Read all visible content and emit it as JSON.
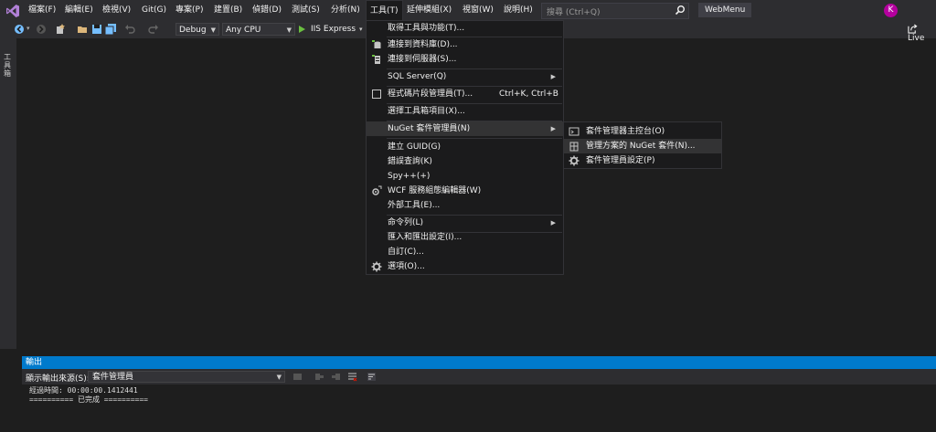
{
  "menubar": {
    "items": [
      "檔案(F)",
      "編輯(E)",
      "檢視(V)",
      "Git(G)",
      "專案(P)",
      "建置(B)",
      "偵錯(D)",
      "測試(S)",
      "分析(N)",
      "工具(T)",
      "延伸模組(X)",
      "視窗(W)",
      "說明(H)"
    ],
    "search_placeholder": "搜尋 (Ctrl+Q)",
    "solution_name": "WebMenu",
    "avatar_initial": "K"
  },
  "toolbar": {
    "config": "Debug",
    "platform": "Any CPU",
    "run_target": "IIS Express",
    "live_share": "Live"
  },
  "side_tab": {
    "label": "工具箱"
  },
  "tools_menu": {
    "items": [
      {
        "label": "取得工具與功能(T)..."
      },
      {
        "label": "連接到資料庫(D)..."
      },
      {
        "label": "連接到伺服器(S)..."
      },
      {
        "label": "SQL Server(Q)"
      },
      {
        "label": "程式碼片段管理員(T)...",
        "shortcut": "Ctrl+K, Ctrl+B"
      },
      {
        "label": "選擇工具箱項目(X)..."
      },
      {
        "label": "NuGet 套件管理員(N)"
      },
      {
        "label": "建立 GUID(G)"
      },
      {
        "label": "錯誤查詢(K)"
      },
      {
        "label": "Spy++(+)"
      },
      {
        "label": "WCF 服務組態編輯器(W)"
      },
      {
        "label": "外部工具(E)..."
      },
      {
        "label": "命令列(L)"
      },
      {
        "label": "匯入和匯出設定(I)..."
      },
      {
        "label": "自訂(C)..."
      },
      {
        "label": "選項(O)..."
      }
    ]
  },
  "nuget_submenu": {
    "items": [
      {
        "label": "套件管理器主控台(O)"
      },
      {
        "label": "管理方案的 NuGet 套件(N)..."
      },
      {
        "label": "套件管理員設定(P)"
      }
    ]
  },
  "output": {
    "title": "輸出",
    "source_label": "顯示輸出來源(S):",
    "source_value": "套件管理員",
    "lines": [
      "經過時間: 00:00:00.1412441",
      "========== 已完成 =========="
    ]
  },
  "colors": {
    "menubar_bg": "#2d2d30",
    "editor_bg": "#1e1e1e",
    "menu_bg": "#1b1b1c",
    "accent": "#007acc",
    "run_green": "#6abf40",
    "avatar": "#b4009e"
  }
}
